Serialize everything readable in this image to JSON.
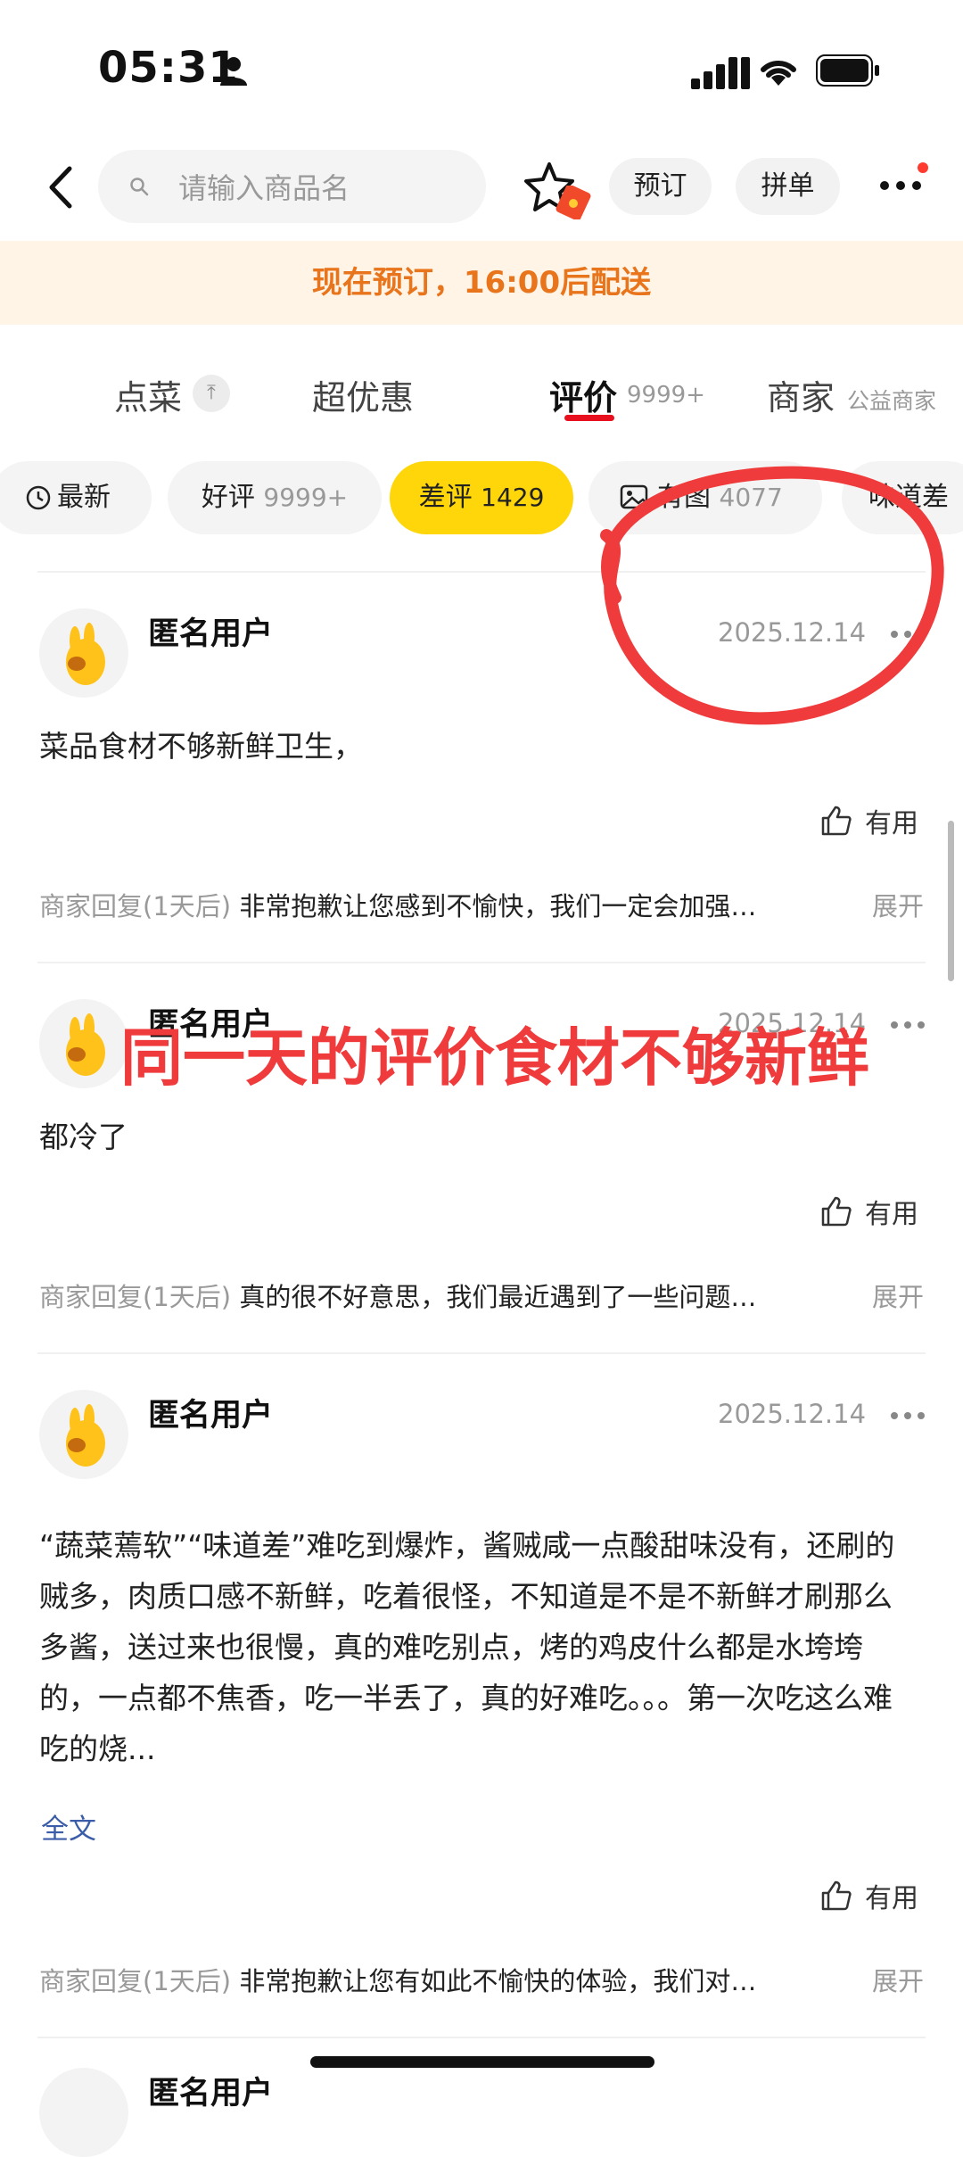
{
  "status": {
    "time": "05:31"
  },
  "search": {
    "placeholder": "请输入商品名"
  },
  "header": {
    "book_label": "预订",
    "group_label": "拼单"
  },
  "banner": {
    "text": "现在预订，16:00后配送"
  },
  "tabs": [
    {
      "label": "点菜"
    },
    {
      "label": "超优惠"
    },
    {
      "label": "评价",
      "count": "9999+"
    },
    {
      "label": "商家",
      "sub": "公益商家"
    }
  ],
  "filters": [
    {
      "label": "最新",
      "count": ""
    },
    {
      "label": "好评",
      "count": "9999+"
    },
    {
      "label": "差评",
      "count": "1429"
    },
    {
      "label": "有图",
      "count": "4077"
    },
    {
      "label": "味道差",
      "count": ""
    }
  ],
  "reviews": [
    {
      "user": "匿名用户",
      "date": "2025.12.14",
      "text": "菜品食材不够新鲜卫生，",
      "useful_label": "有用",
      "reply_label": "商家回复(1天后)",
      "reply_text": "非常抱歉让您感到不愉快，我们一定会加强…",
      "expand_label": "展开"
    },
    {
      "user": "匿名用户",
      "date": "2025.12.14",
      "text": "都冷了",
      "useful_label": "有用",
      "reply_label": "商家回复(1天后)",
      "reply_text": "真的很不好意思，我们最近遇到了一些问题…",
      "expand_label": "展开"
    },
    {
      "user": "匿名用户",
      "date": "2025.12.14",
      "text": "“蔬菜蔫软”“味道差”难吃到爆炸，酱贼咸一点酸甜味没有，还刷的贼多，肉质口感不新鲜，吃着很怪，不知道是不是不新鲜才刷那么多酱，送过来也很慢，真的难吃别点，烤的鸡皮什么都是水垮垮的，一点都不焦香，吃一半丢了，真的好难吃。。。第一次吃这么难吃的烧...",
      "full_label": "全文",
      "useful_label": "有用",
      "reply_label": "商家回复(1天后)",
      "reply_text": "非常抱歉让您有如此不愉快的体验，我们对…",
      "expand_label": "展开"
    },
    {
      "user": "匿名用户"
    }
  ],
  "annotation": {
    "text": "同一天的评价食材不够新鲜"
  },
  "colors": {
    "accent_yellow": "#ffd60a",
    "banner_orange": "#e8741b",
    "annotation_red": "#ef3b3b",
    "tab_underline": "#e8101e"
  },
  "icons": [
    "person-icon",
    "signal-icon",
    "wifi-icon",
    "battery-icon",
    "back-icon",
    "search-icon",
    "star-icon",
    "red-packet-icon",
    "more-icon",
    "pin-icon",
    "clock-icon",
    "image-icon",
    "thumb-up-icon"
  ]
}
